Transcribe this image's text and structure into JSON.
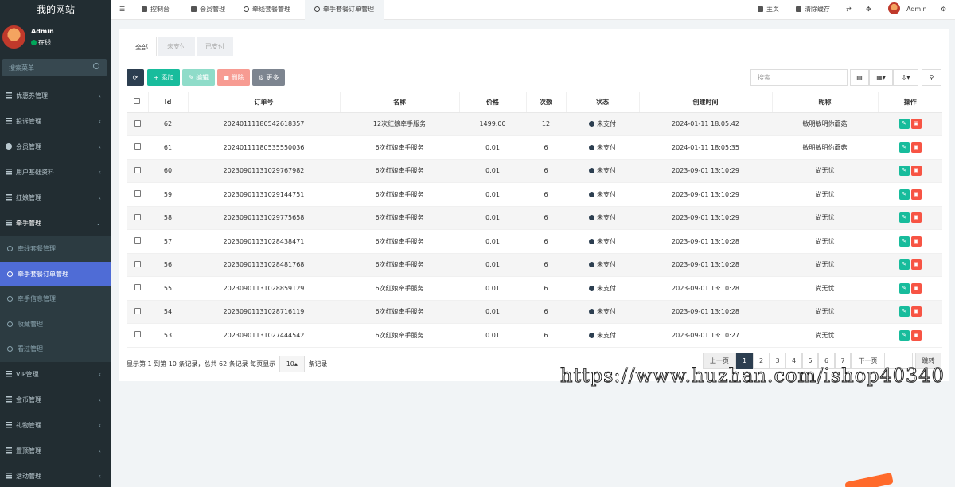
{
  "sidebar": {
    "brand": "我的网站",
    "user": {
      "name": "Admin",
      "status": "在线"
    },
    "search_placeholder": "搜索菜单",
    "items": [
      {
        "label": "优惠券管理",
        "icon": "list-icon"
      },
      {
        "label": "投诉管理",
        "icon": "list-icon"
      },
      {
        "label": "会员管理",
        "icon": "user-icon"
      },
      {
        "label": "用户基础资料",
        "icon": "list-icon"
      },
      {
        "label": "红娘管理",
        "icon": "list-icon"
      },
      {
        "label": "牵手管理",
        "icon": "list-icon",
        "open": true
      },
      {
        "label": "VIP管理",
        "icon": "list-icon"
      },
      {
        "label": "金币管理",
        "icon": "list-icon"
      },
      {
        "label": "礼物管理",
        "icon": "list-icon"
      },
      {
        "label": "置顶管理",
        "icon": "list-icon"
      },
      {
        "label": "活动管理",
        "icon": "list-icon"
      }
    ],
    "subitems": [
      {
        "label": "牵线套餐管理"
      },
      {
        "label": "牵手套餐订单管理",
        "active": true
      },
      {
        "label": "牵手信息管理"
      },
      {
        "label": "收藏管理"
      },
      {
        "label": "看过管理"
      }
    ]
  },
  "topbar": {
    "tabs": [
      "控制台",
      "会员管理",
      "牵线套餐管理",
      "牵手套餐订单管理"
    ],
    "home": "主页",
    "clear_cache": "清除缓存",
    "user": "Admin"
  },
  "filter_tabs": [
    "全部",
    "未支付",
    "已支付"
  ],
  "toolbar": {
    "add": "添加",
    "edit": "编辑",
    "delete": "删除",
    "more": "更多",
    "search_placeholder": "搜索"
  },
  "columns": [
    "Id",
    "订单号",
    "名称",
    "价格",
    "次数",
    "状态",
    "创建时间",
    "昵称",
    "操作"
  ],
  "rows": [
    {
      "id": "62",
      "order": "20240111180542618357",
      "name": "12次红娘牵手服务",
      "price": "1499.00",
      "count": "12",
      "status": "未支付",
      "time": "2024-01-11 18:05:42",
      "nick": "敏明敏明你蘑菇"
    },
    {
      "id": "61",
      "order": "20240111180535550036",
      "name": "6次红娘牵手服务",
      "price": "0.01",
      "count": "6",
      "status": "未支付",
      "time": "2024-01-11 18:05:35",
      "nick": "敏明敏明你蘑菇"
    },
    {
      "id": "60",
      "order": "20230901131029767982",
      "name": "6次红娘牵手服务",
      "price": "0.01",
      "count": "6",
      "status": "未支付",
      "time": "2023-09-01 13:10:29",
      "nick": "尚无忧"
    },
    {
      "id": "59",
      "order": "20230901131029144751",
      "name": "6次红娘牵手服务",
      "price": "0.01",
      "count": "6",
      "status": "未支付",
      "time": "2023-09-01 13:10:29",
      "nick": "尚无忧"
    },
    {
      "id": "58",
      "order": "20230901131029775658",
      "name": "6次红娘牵手服务",
      "price": "0.01",
      "count": "6",
      "status": "未支付",
      "time": "2023-09-01 13:10:29",
      "nick": "尚无忧"
    },
    {
      "id": "57",
      "order": "20230901131028438471",
      "name": "6次红娘牵手服务",
      "price": "0.01",
      "count": "6",
      "status": "未支付",
      "time": "2023-09-01 13:10:28",
      "nick": "尚无忧"
    },
    {
      "id": "56",
      "order": "20230901131028481768",
      "name": "6次红娘牵手服务",
      "price": "0.01",
      "count": "6",
      "status": "未支付",
      "time": "2023-09-01 13:10:28",
      "nick": "尚无忧"
    },
    {
      "id": "55",
      "order": "20230901131028859129",
      "name": "6次红娘牵手服务",
      "price": "0.01",
      "count": "6",
      "status": "未支付",
      "time": "2023-09-01 13:10:28",
      "nick": "尚无忧"
    },
    {
      "id": "54",
      "order": "20230901131028716119",
      "name": "6次红娘牵手服务",
      "price": "0.01",
      "count": "6",
      "status": "未支付",
      "time": "2023-09-01 13:10:28",
      "nick": "尚无忧"
    },
    {
      "id": "53",
      "order": "20230901131027444542",
      "name": "6次红娘牵手服务",
      "price": "0.01",
      "count": "6",
      "status": "未支付",
      "time": "2023-09-01 13:10:27",
      "nick": "尚无忧"
    }
  ],
  "pagination": {
    "info_prefix": "显示第 1 到第 10 条记录，总共 62 条记录 每页显示",
    "page_size": "10",
    "info_suffix": "条记录",
    "prev": "上一页",
    "next": "下一页",
    "pages": [
      "1",
      "2",
      "3",
      "4",
      "5",
      "6",
      "7"
    ],
    "jump": "跳转"
  },
  "watermark": "https://www.huzhan.com/ishop40340",
  "colors": {
    "sidebar": "#222d32",
    "active": "#4f6cd6",
    "success": "#18bc9c",
    "danger": "#f75444",
    "dark": "#2c3e50"
  }
}
